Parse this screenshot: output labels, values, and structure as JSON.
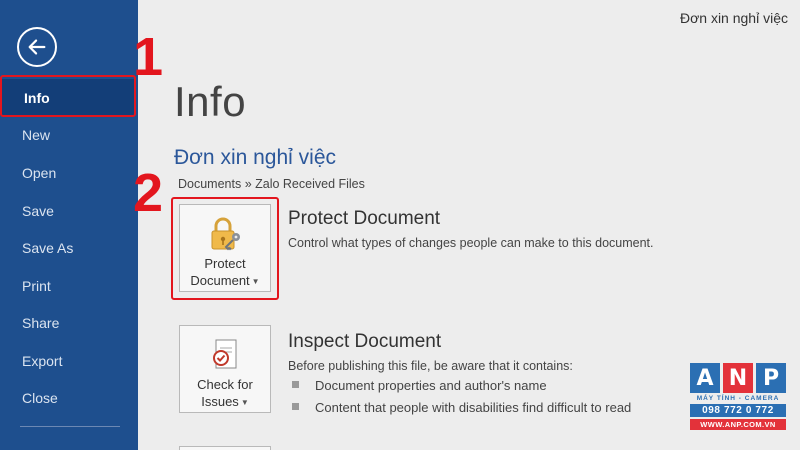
{
  "sidebar": {
    "items": [
      {
        "label": "Info",
        "active": true
      },
      {
        "label": "New"
      },
      {
        "label": "Open"
      },
      {
        "label": "Save"
      },
      {
        "label": "Save As"
      },
      {
        "label": "Print"
      },
      {
        "label": "Share"
      },
      {
        "label": "Export"
      },
      {
        "label": "Close"
      }
    ]
  },
  "header": {
    "document_name": "Đơn xin nghỉ việc"
  },
  "main": {
    "title": "Info",
    "file_name": "Đơn xin nghỉ việc",
    "breadcrumb": "Documents » Zalo Received Files",
    "protect": {
      "tile_line1": "Protect",
      "tile_line2": "Document",
      "title": "Protect Document",
      "description": "Control what types of changes people can make to this document."
    },
    "inspect": {
      "tile_line1": "Check for",
      "tile_line2": "Issues",
      "title": "Inspect Document",
      "description": "Before publishing this file, be aware that it contains:",
      "bullets": [
        "Document properties and author's name",
        "Content that people with disabilities find difficult to read"
      ]
    }
  },
  "annotations": {
    "step1": "1",
    "step2": "2",
    "color": "#e3161e"
  },
  "watermark": {
    "letters": [
      "A",
      "N",
      "P"
    ],
    "letter_colors": [
      "#2b6fb3",
      "#e3323a",
      "#2b6fb3"
    ],
    "subtitle": "MÁY TÍNH - CAMERA",
    "phone": "098 772 0 772",
    "website": "WWW.ANP.COM.VN"
  },
  "colors": {
    "sidebar": "#1e4f8e",
    "accent": "#2b579a",
    "background": "#ededed"
  }
}
